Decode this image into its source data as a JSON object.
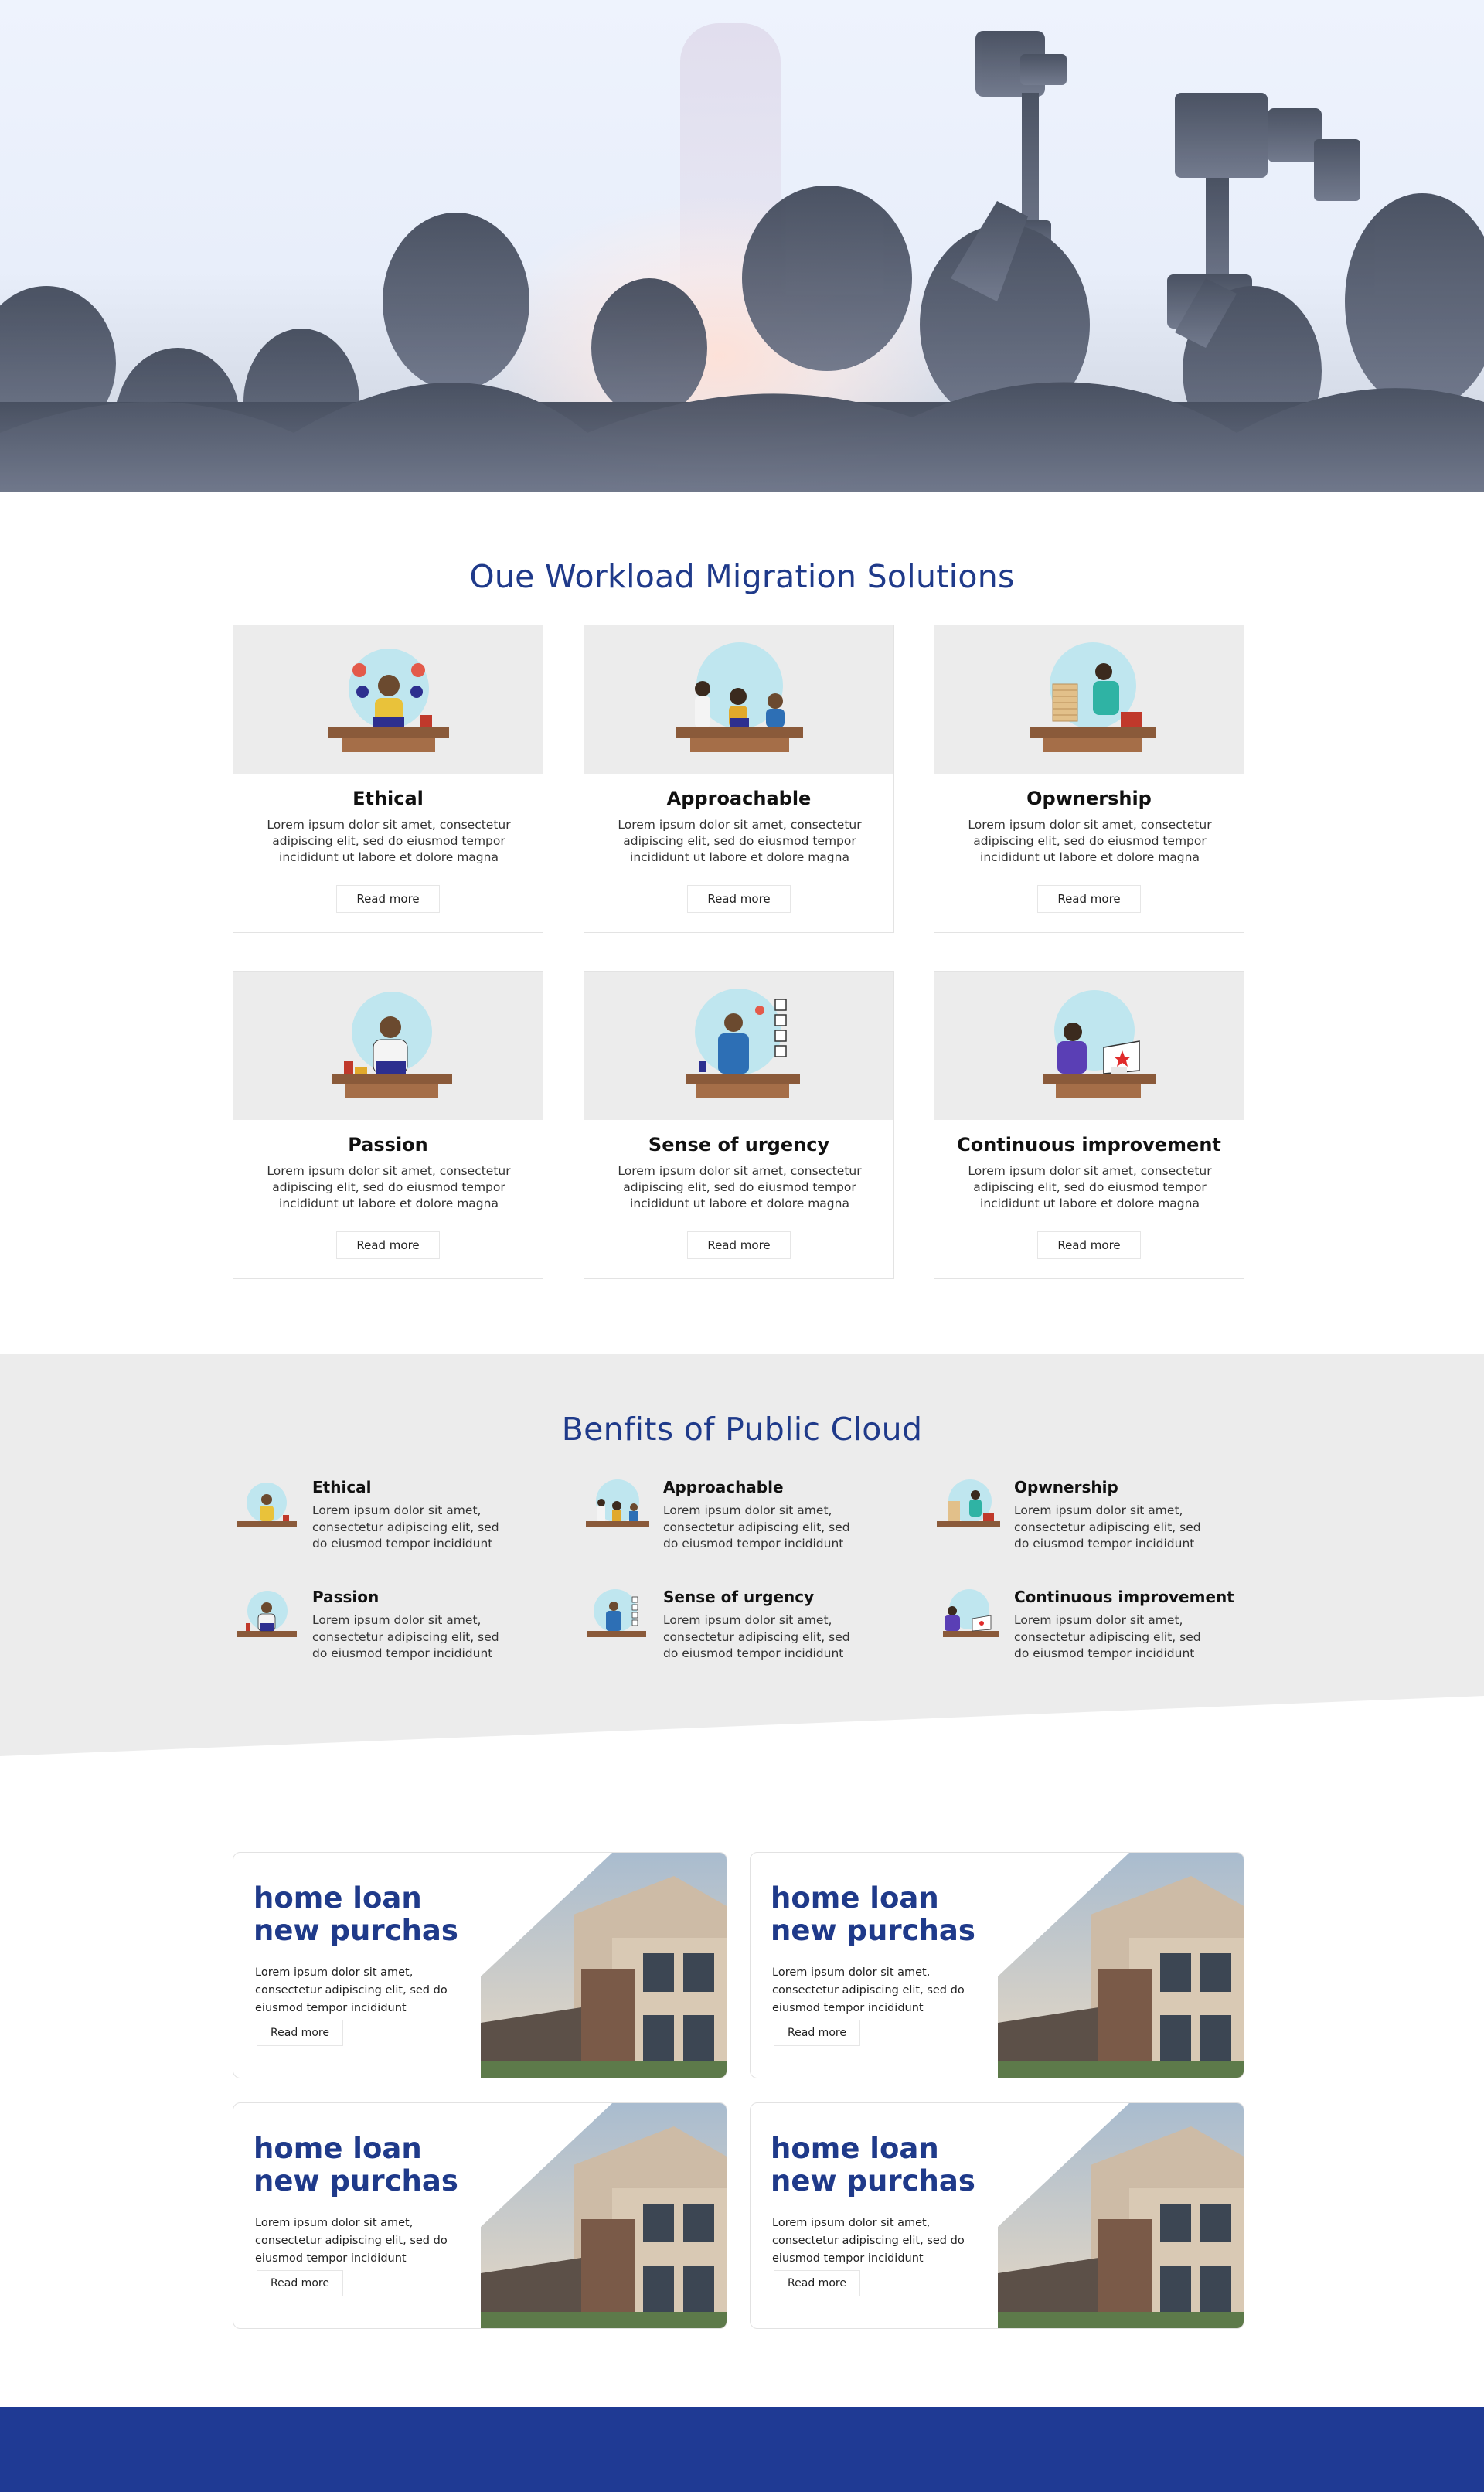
{
  "hero": {
    "scene": "press-conference-crowd-with-cameras"
  },
  "solutions": {
    "title": "Oue Workload Migration Solutions",
    "cards": [
      {
        "title": "Ethical",
        "desc": "Lorem ipsum dolor sit amet, consectetur adipiscing elit, sed do eiusmod tempor incididunt ut labore et dolore magna",
        "button": "Read more",
        "illustration": "multitasking-person-icon"
      },
      {
        "title": "Approachable",
        "desc": "Lorem ipsum dolor sit amet, consectetur adipiscing elit, sed do eiusmod tempor incididunt ut labore et dolore magna",
        "button": "Read more",
        "illustration": "team-meeting-icon"
      },
      {
        "title": "Opwnership",
        "desc": "Lorem ipsum dolor sit amet, consectetur adipiscing elit, sed do eiusmod tempor incididunt ut labore et dolore magna",
        "button": "Read more",
        "illustration": "stacking-blocks-icon"
      },
      {
        "title": "Passion",
        "desc": "Lorem ipsum dolor sit amet, consectetur adipiscing elit, sed do eiusmod tempor incididunt ut labore et dolore magna",
        "button": "Read more",
        "illustration": "laptop-worker-icon"
      },
      {
        "title": "Sense of urgency",
        "desc": "Lorem ipsum dolor sit amet, consectetur adipiscing elit, sed do eiusmod tempor incididunt ut labore et dolore magna",
        "button": "Read more",
        "illustration": "checklist-person-icon"
      },
      {
        "title": "Continuous improvement",
        "desc": "Lorem ipsum dolor sit amet, consectetur adipiscing elit, sed do eiusmod tempor incididunt ut labore et dolore magna",
        "button": "Read more",
        "illustration": "designer-tablet-icon"
      }
    ]
  },
  "benefits": {
    "title": "Benfits of Public Cloud",
    "items": [
      {
        "title": "Ethical",
        "desc": "Lorem ipsum dolor sit amet, consectetur adipiscing elit, sed do eiusmod tempor incididunt"
      },
      {
        "title": "Approachable",
        "desc": "Lorem ipsum dolor sit amet, consectetur adipiscing elit, sed do eiusmod tempor incididunt"
      },
      {
        "title": "Opwnership",
        "desc": "Lorem ipsum dolor sit amet, consectetur adipiscing elit, sed do eiusmod tempor incididunt"
      },
      {
        "title": "Passion",
        "desc": "Lorem ipsum dolor sit amet, consectetur adipiscing elit, sed do eiusmod tempor incididunt"
      },
      {
        "title": "Sense of urgency",
        "desc": "Lorem ipsum dolor sit amet, consectetur adipiscing elit, sed do eiusmod tempor incididunt"
      },
      {
        "title": "Continuous improvement",
        "desc": "Lorem ipsum dolor sit amet, consectetur adipiscing elit, sed do eiusmod tempor incididunt"
      }
    ]
  },
  "loans": [
    {
      "title_line1": "home loan",
      "title_line2": "new purchas",
      "desc": "Lorem ipsum dolor sit amet, consectetur adipiscing elit, sed do eiusmod tempor incididunt",
      "button": "Read more"
    },
    {
      "title_line1": "home loan",
      "title_line2": "new purchas",
      "desc": "Lorem ipsum dolor sit amet, consectetur adipiscing elit, sed do eiusmod tempor incididunt",
      "button": "Read more"
    },
    {
      "title_line1": "home loan",
      "title_line2": "new purchas",
      "desc": "Lorem ipsum dolor sit amet, consectetur adipiscing elit, sed do eiusmod tempor incididunt",
      "button": "Read more"
    },
    {
      "title_line1": "home loan",
      "title_line2": "new purchas",
      "desc": "Lorem ipsum dolor sit amet, consectetur adipiscing elit, sed do eiusmod tempor incididunt",
      "button": "Read more"
    }
  ],
  "colors": {
    "brand_blue": "#1f3a8a",
    "footer_blue": "#1f3a94",
    "section_gray": "#ececec",
    "illustration_circle": "#bfe6ef",
    "desk_brown": "#8a5a3a"
  }
}
